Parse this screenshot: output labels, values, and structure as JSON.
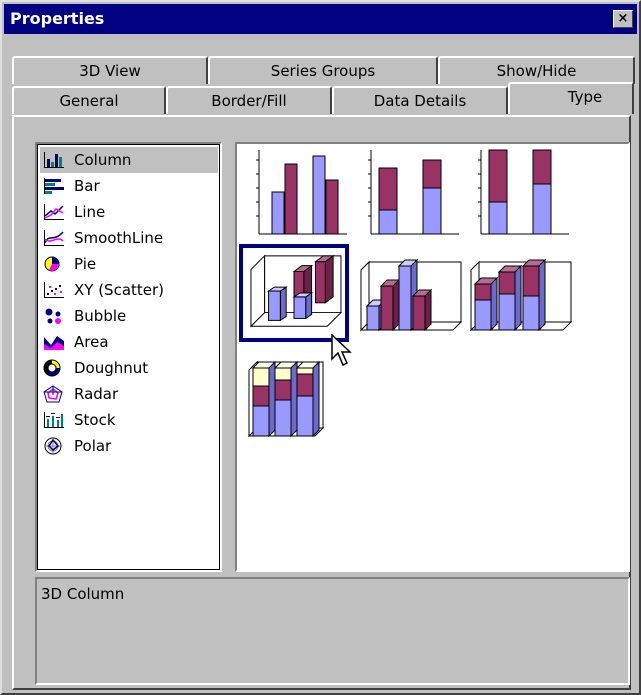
{
  "window": {
    "title": "Properties",
    "close_glyph": "×"
  },
  "tabs_back": [
    {
      "label": "3D View"
    },
    {
      "label": "Series Groups"
    },
    {
      "label": "Show/Hide"
    }
  ],
  "tabs_front": [
    {
      "label": "General"
    },
    {
      "label": "Border/Fill"
    },
    {
      "label": "Data Details"
    },
    {
      "label": "Type",
      "active": true
    }
  ],
  "chart_types": [
    {
      "label": "Column",
      "icon": "column-chart-icon",
      "selected": true
    },
    {
      "label": "Bar",
      "icon": "bar-chart-icon"
    },
    {
      "label": "Line",
      "icon": "line-chart-icon"
    },
    {
      "label": "SmoothLine",
      "icon": "smoothline-chart-icon"
    },
    {
      "label": "Pie",
      "icon": "pie-chart-icon"
    },
    {
      "label": "XY (Scatter)",
      "icon": "scatter-chart-icon"
    },
    {
      "label": "Bubble",
      "icon": "bubble-chart-icon"
    },
    {
      "label": "Area",
      "icon": "area-chart-icon"
    },
    {
      "label": "Doughnut",
      "icon": "doughnut-chart-icon"
    },
    {
      "label": "Radar",
      "icon": "radar-chart-icon"
    },
    {
      "label": "Stock",
      "icon": "stock-chart-icon"
    },
    {
      "label": "Polar",
      "icon": "polar-chart-icon"
    }
  ],
  "subtypes": [
    {
      "name": "clustered-column",
      "selected": false
    },
    {
      "name": "stacked-column",
      "selected": false
    },
    {
      "name": "100-stacked-column",
      "selected": false
    },
    {
      "name": "3d-column",
      "selected": true
    },
    {
      "name": "3d-clustered-column",
      "selected": false
    },
    {
      "name": "3d-stacked-column",
      "selected": false
    },
    {
      "name": "3d-100-stacked-column",
      "selected": false
    }
  ],
  "description": "3D Column",
  "colors": {
    "title_bar": "#000080",
    "series_a": "#9999ff",
    "series_b": "#993366",
    "series_c": "#ffffcc",
    "face": "#c0c0c0"
  }
}
